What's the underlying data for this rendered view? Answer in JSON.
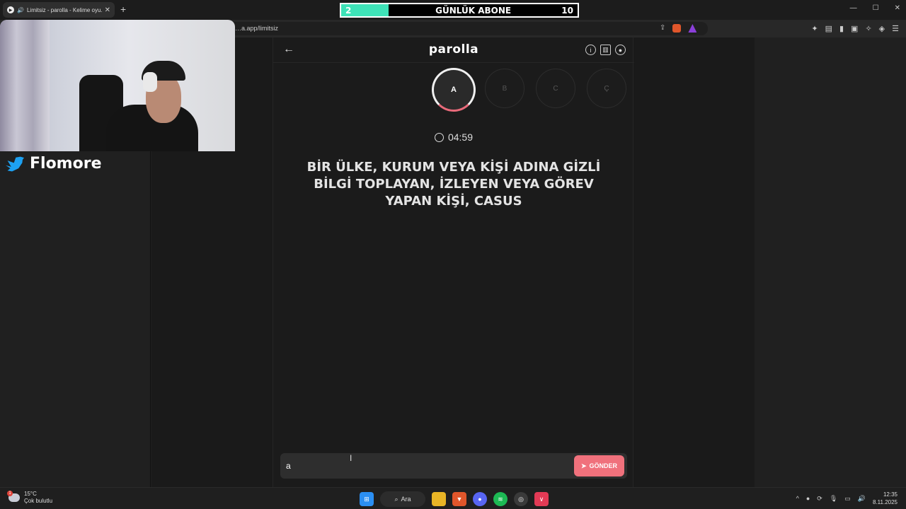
{
  "browser": {
    "tab_title": "Limitsiz - parolla - Kelime oyu...",
    "tab_close": "✕",
    "new_tab": "+",
    "url": "…a.app/limitsiz",
    "window_controls": [
      "—",
      "☐",
      "✕"
    ]
  },
  "overlay": {
    "subs_current": "2",
    "subs_label": "GÜNLÜK ABONE",
    "subs_goal": "10",
    "subs_progress_fraction": 0.2,
    "handle": "Flomore"
  },
  "app": {
    "brand": "parolla",
    "back_icon": "←",
    "letters": [
      {
        "label": "A",
        "active": true
      },
      {
        "label": "B",
        "active": false
      },
      {
        "label": "C",
        "active": false
      },
      {
        "label": "Ç",
        "active": false
      }
    ],
    "timer": "04:59",
    "question": "BİR ÜLKE, KURUM VEYA KİŞİ ADINA GİZLİ BİLGİ TOPLAYAN, İZLEYEN VEYA GÖREV YAPAN KİŞİ, CASUS",
    "answer_value": "a",
    "send_label": "GÖNDER",
    "accent_color": "#f0717c"
  },
  "taskbar": {
    "temperature": "15°C",
    "weather": "Çok bulutlu",
    "weather_badge": "1",
    "search_label": "Ara",
    "time": "12:35",
    "date": "8.11.2025"
  }
}
